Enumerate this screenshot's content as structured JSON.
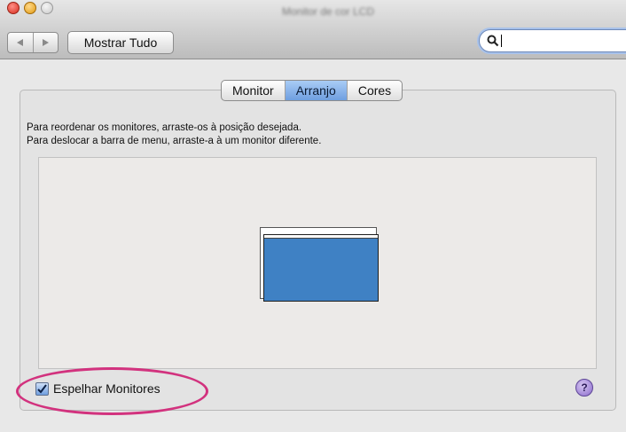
{
  "window": {
    "title": "Monitor de cor LCD"
  },
  "toolbar": {
    "back_icon": "back-arrow-icon",
    "forward_icon": "forward-arrow-icon",
    "show_all_label": "Mostrar Tudo",
    "search_value": ""
  },
  "tabs": [
    {
      "label": "Monitor",
      "active": false
    },
    {
      "label": "Arranjo",
      "active": true
    },
    {
      "label": "Cores",
      "active": false
    }
  ],
  "instructions": {
    "line1": "Para reordenar os monitores, arraste-os à posição desejada.",
    "line2": "Para deslocar a barra de menu, arraste-a à um monitor diferente."
  },
  "mirror": {
    "label": "Espelhar Monitores",
    "checked": true
  },
  "help": {
    "label": "?"
  },
  "colors": {
    "accent": "#6f9fe0",
    "monitor_fill": "#3f81c4",
    "highlight": "#d2327e"
  }
}
